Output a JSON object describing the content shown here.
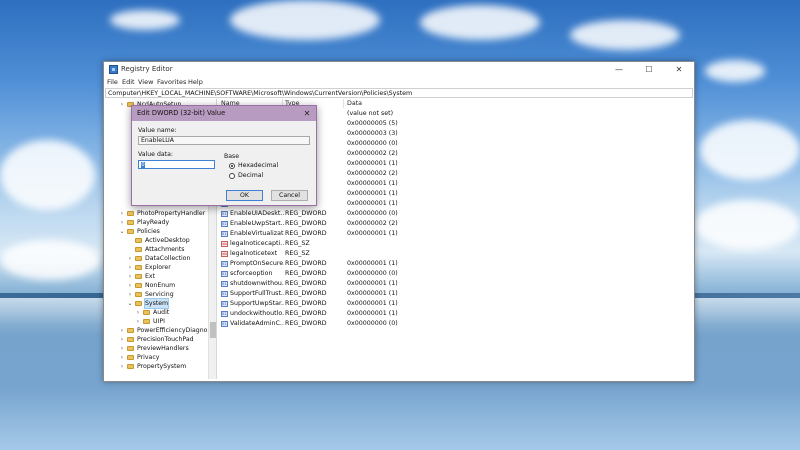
{
  "window": {
    "title": "Registry Editor",
    "controls": {
      "minimize": "—",
      "maximize": "☐",
      "close": "✕"
    },
    "menu": [
      "File",
      "Edit",
      "View",
      "Favorites",
      "Help"
    ],
    "address": "Computer\\HKEY_LOCAL_MACHINE\\SOFTWARE\\Microsoft\\Windows\\CurrentVersion\\Policies\\System"
  },
  "tree": {
    "items": [
      {
        "label": "NcdAutoSetup",
        "expandable": true,
        "expanded": false,
        "depth": 0
      },
      {
        "label": "PhotoPropertyHandler",
        "expandable": true,
        "expanded": false,
        "depth": 0
      },
      {
        "label": "PlayReady",
        "expandable": true,
        "expanded": false,
        "depth": 0
      },
      {
        "label": "Policies",
        "expandable": true,
        "expanded": true,
        "depth": 0
      },
      {
        "label": "ActiveDesktop",
        "expandable": false,
        "expanded": false,
        "depth": 1
      },
      {
        "label": "Attachments",
        "expandable": false,
        "expanded": false,
        "depth": 1
      },
      {
        "label": "DataCollection",
        "expandable": true,
        "expanded": false,
        "depth": 1
      },
      {
        "label": "Explorer",
        "expandable": true,
        "expanded": false,
        "depth": 1
      },
      {
        "label": "Ext",
        "expandable": true,
        "expanded": false,
        "depth": 1
      },
      {
        "label": "NonEnum",
        "expandable": true,
        "expanded": false,
        "depth": 1
      },
      {
        "label": "Servicing",
        "expandable": true,
        "expanded": false,
        "depth": 1
      },
      {
        "label": "System",
        "expandable": true,
        "expanded": true,
        "depth": 1,
        "selected": true
      },
      {
        "label": "Audit",
        "expandable": true,
        "expanded": false,
        "depth": 2
      },
      {
        "label": "UIPI",
        "expandable": true,
        "expanded": false,
        "depth": 2
      },
      {
        "label": "PowerEfficiencyDiagno",
        "expandable": true,
        "expanded": false,
        "depth": 0
      },
      {
        "label": "PrecisionTouchPad",
        "expandable": true,
        "expanded": false,
        "depth": 0
      },
      {
        "label": "PreviewHandlers",
        "expandable": true,
        "expanded": false,
        "depth": 0
      },
      {
        "label": "Privacy",
        "expandable": true,
        "expanded": false,
        "depth": 0
      },
      {
        "label": "PropertySystem",
        "expandable": true,
        "expanded": false,
        "depth": 0
      }
    ]
  },
  "values": {
    "headers": {
      "name": "Name",
      "type": "Type",
      "data": "Data"
    },
    "rows": [
      {
        "name": "",
        "type": "",
        "data": "(value not set)",
        "icon": "string-value-icon"
      },
      {
        "name": "",
        "type": "",
        "data": "0x00000005 (5)",
        "icon": "dword-value-icon"
      },
      {
        "name": "",
        "type": "",
        "data": "0x00000003 (3)",
        "icon": "dword-value-icon"
      },
      {
        "name": "",
        "type": "",
        "data": "0x00000000 (0)",
        "icon": "dword-value-icon"
      },
      {
        "name": "",
        "type": "",
        "data": "0x00000002 (2)",
        "icon": "dword-value-icon"
      },
      {
        "name": "",
        "type": "",
        "data": "0x00000001 (1)",
        "icon": "dword-value-icon"
      },
      {
        "name": "",
        "type": "",
        "data": "0x00000002 (2)",
        "icon": "dword-value-icon"
      },
      {
        "name": "",
        "type": "",
        "data": "0x00000001 (1)",
        "icon": "dword-value-icon"
      },
      {
        "name": "",
        "type": "",
        "data": "0x00000001 (1)",
        "icon": "dword-value-icon"
      },
      {
        "name": "",
        "type": "",
        "data": "0x00000001 (1)",
        "icon": "dword-value-icon"
      },
      {
        "name": "EnableUIADeskt...",
        "type": "REG_DWORD",
        "data": "0x00000000 (0)",
        "icon": "dword-value-icon"
      },
      {
        "name": "EnableUwpStart...",
        "type": "REG_DWORD",
        "data": "0x00000002 (2)",
        "icon": "dword-value-icon"
      },
      {
        "name": "EnableVirtualizat...",
        "type": "REG_DWORD",
        "data": "0x00000001 (1)",
        "icon": "dword-value-icon"
      },
      {
        "name": "legalnoticecapti...",
        "type": "REG_SZ",
        "data": "",
        "icon": "string-value-icon"
      },
      {
        "name": "legalnoticetext",
        "type": "REG_SZ",
        "data": "",
        "icon": "string-value-icon"
      },
      {
        "name": "PromptOnSecure...",
        "type": "REG_DWORD",
        "data": "0x00000001 (1)",
        "icon": "dword-value-icon"
      },
      {
        "name": "scforceoption",
        "type": "REG_DWORD",
        "data": "0x00000000 (0)",
        "icon": "dword-value-icon"
      },
      {
        "name": "shutdownwithou...",
        "type": "REG_DWORD",
        "data": "0x00000001 (1)",
        "icon": "dword-value-icon"
      },
      {
        "name": "SupportFullTrust...",
        "type": "REG_DWORD",
        "data": "0x00000001 (1)",
        "icon": "dword-value-icon"
      },
      {
        "name": "SupportUwpStar...",
        "type": "REG_DWORD",
        "data": "0x00000001 (1)",
        "icon": "dword-value-icon"
      },
      {
        "name": "undockwithoutlo...",
        "type": "REG_DWORD",
        "data": "0x00000001 (1)",
        "icon": "dword-value-icon"
      },
      {
        "name": "ValidateAdminC...",
        "type": "REG_DWORD",
        "data": "0x00000000 (0)",
        "icon": "dword-value-icon"
      }
    ]
  },
  "dialog": {
    "title": "Edit DWORD (32-bit) Value",
    "close": "✕",
    "value_name_label": "Value name:",
    "value_name": "EnableLUA",
    "value_data_label": "Value data:",
    "value_data": "0",
    "base_label": "Base",
    "base_options": [
      {
        "label": "Hexadecimal",
        "checked": true
      },
      {
        "label": "Decimal",
        "checked": false
      }
    ],
    "ok_label": "OK",
    "cancel_label": "Cancel"
  },
  "colors": {
    "dialog_title_bg": "#b89bc0",
    "selection": "#cce4f7",
    "focus": "#3f7fd6"
  }
}
